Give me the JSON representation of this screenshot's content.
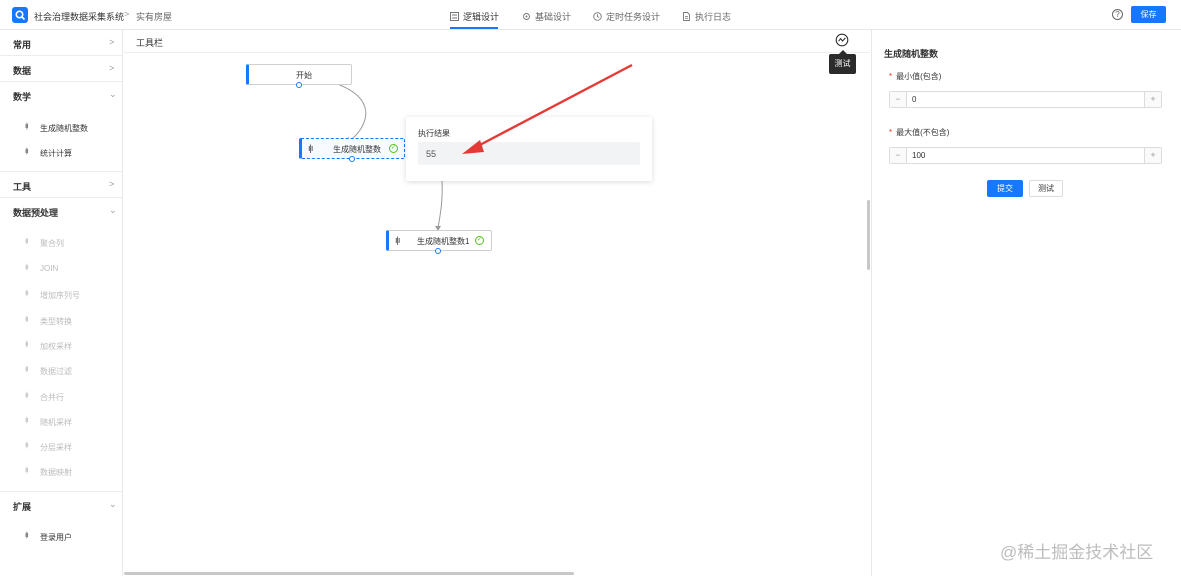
{
  "header": {
    "app_title": "社会治理数据采集系统",
    "breadcrumb_sep": ">",
    "breadcrumb": "实有房屋",
    "tabs": [
      {
        "label": "逻辑设计",
        "active": true,
        "icon": "flow-icon"
      },
      {
        "label": "基础设计",
        "active": false,
        "icon": "gear-icon"
      },
      {
        "label": "定时任务设计",
        "active": false,
        "icon": "clock-icon"
      },
      {
        "label": "执行日志",
        "active": false,
        "icon": "document-icon"
      }
    ],
    "help": "?",
    "save_label": "保存",
    "accent": "#1677ff"
  },
  "sidebar": {
    "groups": [
      {
        "label": "常用",
        "expanded": false,
        "chevron": ">"
      },
      {
        "label": "数据",
        "expanded": false,
        "chevron": ">"
      },
      {
        "label": "数学",
        "expanded": true,
        "chevron": "⌄"
      },
      {
        "label": "工具",
        "expanded": false,
        "chevron": ">"
      },
      {
        "label": "数据预处理",
        "expanded": true,
        "chevron": "⌄"
      },
      {
        "label": "扩展",
        "expanded": true,
        "chevron": "⌄"
      }
    ],
    "math_items": [
      "生成随机整数",
      "统计计算"
    ],
    "preprocess_items": [
      "聚合列",
      "JOIN",
      "增加序列号",
      "类型转换",
      "加权采样",
      "数据过滤",
      "合并行",
      "随机采样",
      "分层采样",
      "数据映射"
    ],
    "extend_items": [
      "登录用户"
    ],
    "item_icon": "ı|ı"
  },
  "canvas": {
    "toolbar_label": "工具栏",
    "test_tooltip": "测试",
    "nodes": {
      "start": "开始",
      "rand1": "生成随机整数",
      "rand2": "生成随机整数1"
    },
    "node_icon": "ı|ı",
    "check": "✓",
    "result": {
      "title": "执行结果",
      "value": "55"
    },
    "arrow_color": "#e53935"
  },
  "panel": {
    "title": "生成随机整数",
    "min_label": "最小值(包含)",
    "min_value": "0",
    "max_label": "最大值(不包含)",
    "max_value": "100",
    "required_mark": "*",
    "minus": "−",
    "plus": "+",
    "submit_label": "提交",
    "test_label": "测试"
  },
  "watermark": "@稀土掘金技术社区"
}
